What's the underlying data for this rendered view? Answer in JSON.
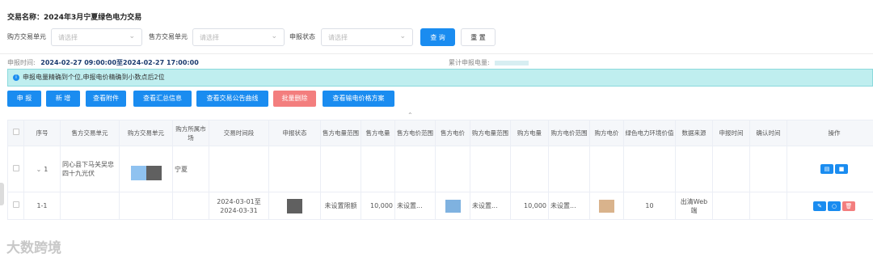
{
  "header": {
    "title": "交易名称：2024年3月宁夏绿色电力交易"
  },
  "filters": {
    "buyer_unit_label": "购方交易单元",
    "buyer_unit_placeholder": "请选择",
    "seller_unit_label": "售方交易单元",
    "seller_unit_placeholder": "请选择",
    "status_label": "申报状态",
    "status_placeholder": "请选择",
    "query_label": "查 询",
    "reset_label": "重 置"
  },
  "info": {
    "time_label": "申报时间:",
    "time_value": "2024-02-27 09:00:00至2024-02-27 17:00:00",
    "total_label": "累计申报电量:"
  },
  "alert": {
    "icon": "info-icon",
    "text": "申报电量精确到个位,申报电价精确到小数点后2位"
  },
  "actions": {
    "declare": "申 报",
    "add": "新 增",
    "view_attachment": "查看附件",
    "view_summary": "查看汇总信息",
    "view_curve": "查看交易公告曲线",
    "batch_delete": "批量删除",
    "view_transmission": "查看输电价格方案"
  },
  "table": {
    "headers": [
      "序号",
      "售方交易单元",
      "购方交易单元",
      "购方所属市场",
      "交易时间段",
      "申报状态",
      "售方电量范围",
      "售方电量",
      "售方电价范围",
      "售方电价",
      "购方电量范围",
      "购方电量",
      "购方电价范围",
      "购方电价",
      "绿色电力环境价值",
      "数据来源",
      "申报时间",
      "确认时间",
      "操作"
    ],
    "rows": [
      {
        "index": "1",
        "seller_unit": "同心县下马关吴忠四十九光伏",
        "market": "宁夏"
      },
      {
        "index": "1-1",
        "period": "2024-03-01至2024-03-31",
        "seller_qty_range": "未设置限额",
        "seller_qty": "10,000",
        "seller_price_range": "未设置...",
        "buyer_qty_range": "未设置...",
        "buyer_qty": "10,000",
        "buyer_price_range": "未设置...",
        "green_value": "10",
        "source": "出清Web端"
      }
    ]
  },
  "colors": {
    "primary": "#1a8cf0",
    "danger": "#f37e7e",
    "alert_bg": "#bfeeef",
    "mask_blue": "#7fb2e0",
    "mask_tan": "#d9b38c",
    "mask_gray": "#606060",
    "orange_icon": "#f37e7e"
  },
  "watermark": "大数跨境"
}
